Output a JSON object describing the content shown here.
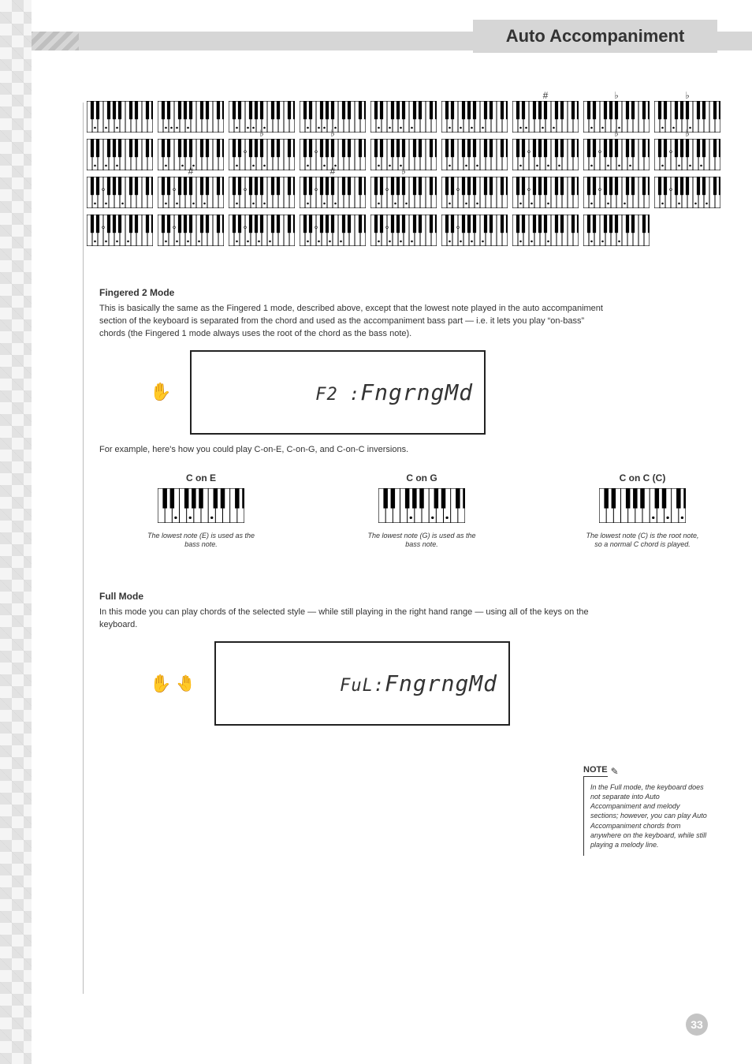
{
  "header": {
    "title": "Auto Accompaniment"
  },
  "fingered2": {
    "heading": "Fingered 2 Mode",
    "paragraph": "This is basically the same as the Fingered 1 mode, described above, except that the lowest note played in the auto accompaniment section of the keyboard is separated from the chord and used as the accompaniment bass part — i.e. it lets you play “on-bass” chords (the Fingered 1 mode always uses the root of the chord as the bass note).",
    "lcd_left": "F2 :",
    "lcd_right": "FngrngMd"
  },
  "example": {
    "intro": "For example, here's how you could play C-on-E, C-on-G, and C-on-C inversions.",
    "cells": [
      {
        "label": "C on E",
        "desc": "The lowest note (E) is used as the bass note."
      },
      {
        "label": "C on G",
        "desc": "The lowest note (G) is used as the bass note."
      },
      {
        "label": "C on C (C)",
        "desc": "The lowest note (C) is the root note, so a normal C chord is played."
      }
    ]
  },
  "full": {
    "heading": "Full Mode",
    "paragraph": "In this mode you can play chords of the selected style — while still playing in the right hand range — using all of the keys on the keyboard.",
    "lcd_left": "FuL:",
    "lcd_right": "FngrngMd"
  },
  "note": {
    "label": "NOTE",
    "body": "In the Full mode, the keyboard does not separate into Auto Accompaniment and melody sections; however, you can play Auto Accompaniment chords from anywhere on the keyboard, while still playing a melody line."
  },
  "chord_rows": [
    {
      "items": [
        {
          "acc": ""
        },
        {
          "acc": ""
        },
        {
          "acc": ""
        },
        {
          "acc": ""
        },
        {
          "acc": ""
        },
        {
          "acc": ""
        },
        {
          "acc": "#"
        },
        {
          "acc": "♭"
        },
        {
          "acc": "♭"
        }
      ]
    },
    {
      "items": [
        {
          "acc": ""
        },
        {
          "acc": ""
        },
        {
          "acc": "♭"
        },
        {
          "acc": "♭"
        },
        {
          "acc": ""
        },
        {
          "acc": ""
        },
        {
          "acc": ""
        },
        {
          "acc": "♭"
        },
        {
          "acc": "♭"
        }
      ]
    },
    {
      "items": [
        {
          "acc": ""
        },
        {
          "acc": "#"
        },
        {
          "acc": ""
        },
        {
          "acc": "#"
        },
        {
          "acc": "♭"
        },
        {
          "acc": ""
        },
        {
          "acc": ""
        },
        {
          "acc": ""
        },
        {
          "acc": ""
        }
      ]
    },
    {
      "items": [
        {
          "acc": ""
        },
        {
          "acc": ""
        },
        {
          "acc": ""
        },
        {
          "acc": ""
        },
        {
          "acc": ""
        },
        {
          "acc": ""
        },
        {
          "acc": ""
        },
        {
          "acc": ""
        }
      ]
    }
  ],
  "page_number": "33"
}
